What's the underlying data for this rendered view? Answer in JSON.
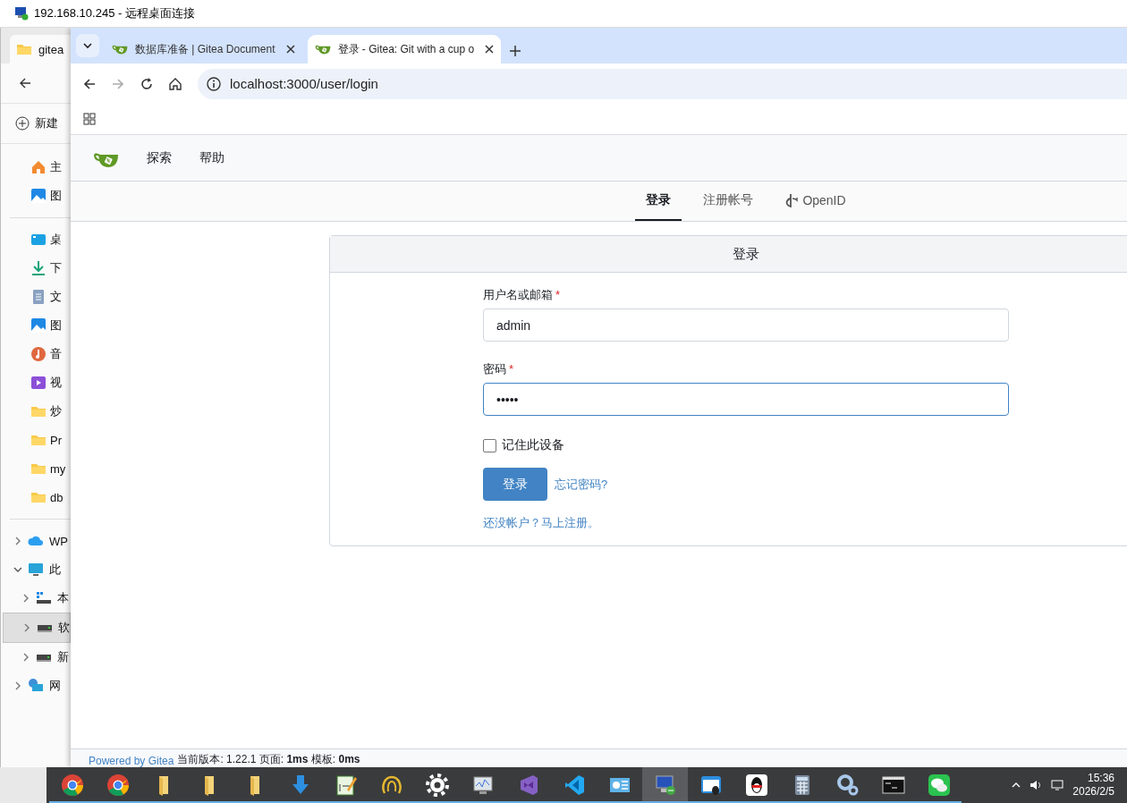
{
  "remote_window": {
    "title": "192.168.10.245 - 远程桌面连接"
  },
  "explorer": {
    "tab": "gitea",
    "new_button": "新建",
    "quick_access": [
      {
        "label": "主",
        "kind": "home"
      },
      {
        "label": "图",
        "kind": "picture"
      }
    ],
    "pinned": [
      {
        "label": "桌",
        "kind": "desktop"
      },
      {
        "label": "下",
        "kind": "download"
      },
      {
        "label": "文",
        "kind": "document"
      },
      {
        "label": "图",
        "kind": "picture"
      },
      {
        "label": "音",
        "kind": "music"
      },
      {
        "label": "视",
        "kind": "video"
      },
      {
        "label": "炒",
        "kind": "folder"
      },
      {
        "label": "Pr",
        "kind": "folder"
      },
      {
        "label": "my",
        "kind": "folder"
      },
      {
        "label": "db",
        "kind": "folder"
      }
    ],
    "tree": [
      {
        "label": "WP",
        "kind": "cloud",
        "expanded": false,
        "selected": false
      },
      {
        "label": "此",
        "kind": "pc",
        "expanded": true,
        "selected": false,
        "children": [
          {
            "label": "本",
            "kind": "drive-windows",
            "expanded": false,
            "selected": false
          },
          {
            "label": "软",
            "kind": "drive",
            "expanded": false,
            "selected": true
          },
          {
            "label": "新",
            "kind": "drive",
            "expanded": false,
            "selected": false
          }
        ]
      },
      {
        "label": "网",
        "kind": "network",
        "expanded": false,
        "selected": false
      }
    ]
  },
  "browser": {
    "tabs": [
      {
        "title": "数据库准备 | Gitea Document",
        "selected": false
      },
      {
        "title": "登录 - Gitea: Git with a cup o",
        "selected": true
      }
    ],
    "address": "localhost:3000/user/login"
  },
  "gitea": {
    "nav": [
      "探索",
      "帮助"
    ],
    "auth_tabs": [
      {
        "label": "登录",
        "selected": true,
        "kind": "text"
      },
      {
        "label": "注册帐号",
        "selected": false,
        "kind": "text"
      },
      {
        "label": "OpenID",
        "selected": false,
        "kind": "openid"
      }
    ],
    "form": {
      "title": "登录",
      "fields": [
        {
          "label": "用户名或邮箱",
          "required_mark": "*",
          "value": "admin",
          "focused": false
        },
        {
          "label": "密码",
          "required_mark": "*",
          "value": "•••••",
          "focused": true
        }
      ],
      "remember": {
        "label": "记住此设备",
        "checked": false
      },
      "submit": "登录",
      "forgot": "忘记密码?",
      "register": "还没帐户？马上注册。"
    },
    "footer": {
      "powered": "Powered by Gitea",
      "version": "当前版本: 1.22.1 页面: **1ms** 模板: **0ms**"
    }
  },
  "taskbar": {
    "items": [
      {
        "kind": "chrome",
        "selected": false
      },
      {
        "kind": "chrome",
        "selected": false
      },
      {
        "kind": "folder",
        "selected": false
      },
      {
        "kind": "folder",
        "selected": false
      },
      {
        "kind": "folder",
        "selected": false
      },
      {
        "kind": "download",
        "selected": false
      },
      {
        "kind": "notepad",
        "selected": false
      },
      {
        "kind": "ring",
        "selected": false
      },
      {
        "kind": "gear",
        "selected": false
      },
      {
        "kind": "monitor",
        "selected": false
      },
      {
        "kind": "vs",
        "selected": false
      },
      {
        "kind": "vscode",
        "selected": false
      },
      {
        "kind": "panel",
        "selected": false
      },
      {
        "kind": "rdp",
        "selected": true
      },
      {
        "kind": "qqwindow",
        "selected": false
      },
      {
        "kind": "qq",
        "selected": false
      },
      {
        "kind": "calculator",
        "selected": false
      },
      {
        "kind": "gears",
        "selected": false
      },
      {
        "kind": "terminal",
        "selected": false
      },
      {
        "kind": "wechat",
        "selected": false
      }
    ],
    "time": "15:36",
    "date": "2026/2/5"
  }
}
